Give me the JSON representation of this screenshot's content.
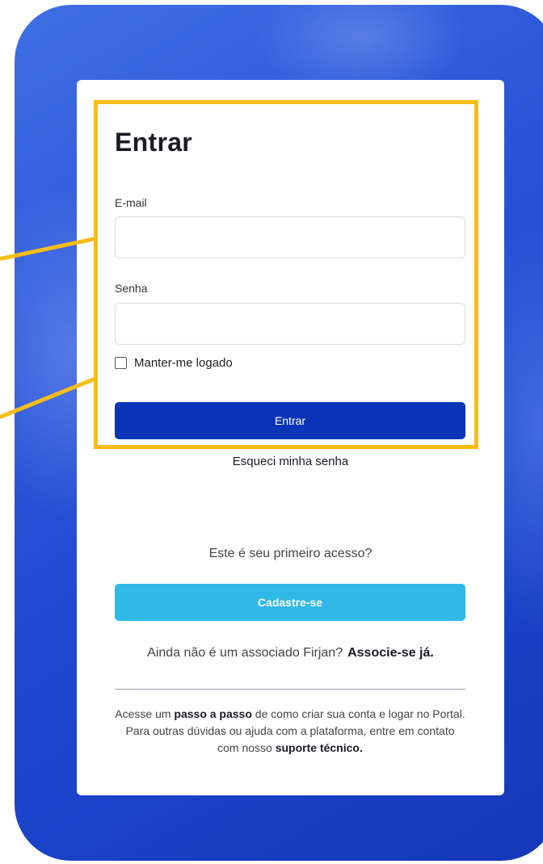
{
  "login": {
    "title": "Entrar",
    "email_label": "E-mail",
    "email_value": "",
    "password_label": "Senha",
    "password_value": "",
    "remember_label": "Manter-me logado",
    "remember_checked": false,
    "submit_label": "Entrar",
    "forgot_password_link": "Esqueci minha senha"
  },
  "signup": {
    "first_access_text": "Este é seu primeiro acesso?",
    "register_button": "Cadastre-se",
    "associate_prompt": "Ainda não é um associado Firjan?",
    "associate_link": "Associe-se já."
  },
  "help": {
    "part1": "Acesse um ",
    "step_link": "passo a passo",
    "part2": " de como criar sua conta e logar no Portal. Para outras dúvidas ou ajuda com a plataforma, entre em contato com nosso ",
    "support_link": "suporte técnico.",
    "part3": ""
  },
  "colors": {
    "background_blue": "#1d47cf",
    "primary_button": "#0a34b8",
    "secondary_button": "#30b8e8",
    "highlight": "#f7bd16"
  }
}
